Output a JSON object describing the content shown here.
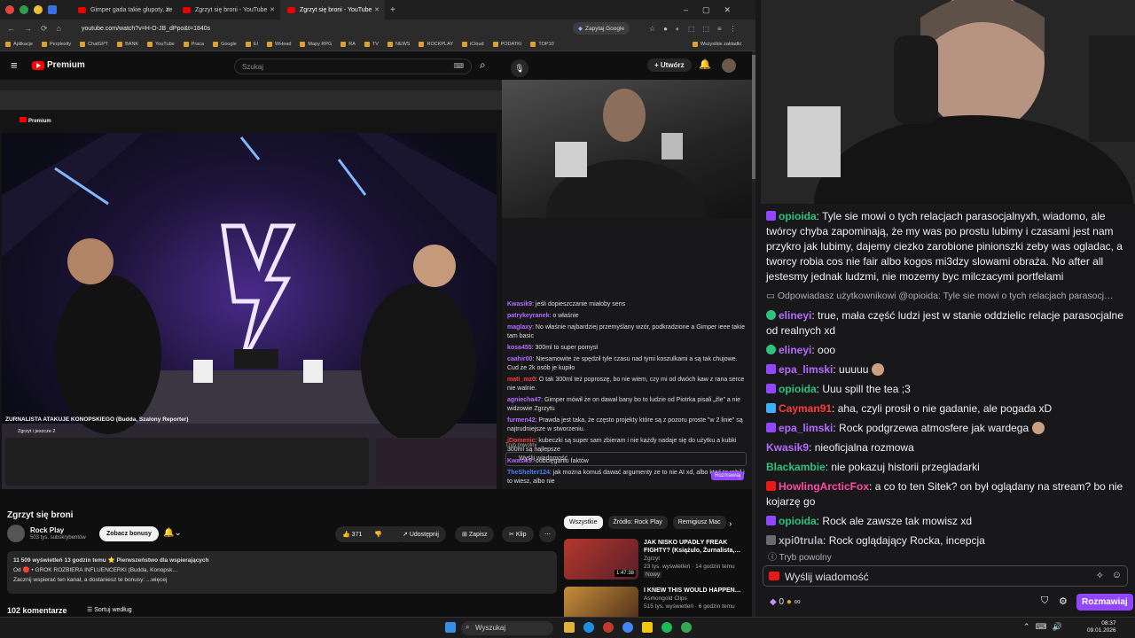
{
  "browser": {
    "tabs": [
      {
        "label": "Gimper gada takie głupoty, że"
      },
      {
        "label": "Zgrzyt się broni - YouTube"
      },
      {
        "label": "Zgrzyt się broni - YouTube"
      }
    ],
    "url": "youtube.com/watch?v=H-O-JB_dPpo&t=1840s",
    "ask_google": "Zapytaj Google",
    "bookmarks": [
      "Aplikacje",
      "Perplexity",
      "ChatGPT",
      "BANK",
      "YouTube",
      "Praca",
      "Google",
      "EI",
      "WHead",
      "Mapy RPG",
      "RA",
      "TV",
      "NEWS",
      "ROCKPLAY",
      "iCloud",
      "PODATKI",
      "TOP10"
    ],
    "all_bookmarks": "Wszystkie zakładki"
  },
  "youtube": {
    "logo": "Premium",
    "search_placeholder": "Szukaj",
    "create": "Utwórz",
    "video_title": "Zgrzyt się broni",
    "channel": "Rock Play",
    "subscribers": "503 tys. subskrybentów",
    "bonus_button": "Zobacz bonusy",
    "likes": "371",
    "share": "Udostępnij",
    "save": "Zapisz",
    "clip": "Klip",
    "desc_line1": "11 509 wyświetleń  13 godzin temu  ⭐ Pierwszeństwo dla wspierających",
    "desc_line2": "Od  🔴 • GROK ROZBIERA INFLUENCERKI (Budda, Konopsk…",
    "desc_line3": "Zacznij wspierać ten kanał, a dostaniesz te bonusy:  ...więcej",
    "comments": "102 komentarze",
    "sort": "Sortuj według",
    "chips": [
      "Wszystkie",
      "Źródło: Rock Play",
      "Remigiusz Mac"
    ],
    "recommendations": [
      {
        "title": "JAK NISKO UPADŁY FREAK FIGHTY? (Książulo, Żurnalista,…",
        "channel": "Zgrzyt",
        "meta": "23 tys. wyświetleń · 14 godzin temu",
        "badge": "Nowy",
        "duration": "1:47:38"
      },
      {
        "title": "I KNEW THIS WOULD HAPPEN…",
        "channel": "Asmongold Clips",
        "meta": "515 tys. wyświetleń · 6 godzin temu",
        "badge": "",
        "duration": ""
      }
    ]
  },
  "inner": {
    "stream_title": "ŻURNALISTA ATAKUJE KONOPSKIEGO (Budda, Szalony Reporter)",
    "channel": "Zgrzyt i jeszcze 2",
    "slow_mode": "Tryb powolny",
    "send_placeholder": "Wyślij wiadomość",
    "chat_button": "Rozmawiaj",
    "messages": [
      {
        "user": "Kwasik9",
        "color": "#b46bff",
        "text": "jeśli dopieszczanie miałoby sens"
      },
      {
        "user": "patrykeyranek",
        "color": "#b46bff",
        "text": "o właśnie"
      },
      {
        "user": "maglaxy",
        "color": "#b46bff",
        "text": "No właśnie najbardziej przemyślany wzór, podkradzione a Gimper ieee takie tam basic"
      },
      {
        "user": "kosa455",
        "color": "#b46bff",
        "text": "300ml to super pomysł"
      },
      {
        "user": "caahir00",
        "color": "#b46bff",
        "text": "Niesamowite że spędził tyle czasu nad tymi koszulkami a są tak chujowe. Cud że 2k osób je kupiło"
      },
      {
        "user": "mati_mz0",
        "color": "#ff3b3b",
        "text": "O tak 300ml też poproszę, bo nie wiem, czy mi od dwóch kaw z rana serce nie walnie."
      },
      {
        "user": "agniecha47",
        "color": "#b46bff",
        "text": "Gimper mówił że on dawał bany bo to ludzie od Piotrka pisali „źle” a nie widzowie Zgrzytu"
      },
      {
        "user": "furmen42",
        "color": "#b46bff",
        "text": "Prawda jest taka, że często projekty które są z pozoru proste \"w 2 linie\" są najtrudniejsze w stworzeniu."
      },
      {
        "user": "iDomenic",
        "color": "#ff3b3b",
        "text": "kubeczki są super sam zbieram i nie każdy nadaje się do użytku a kubki 300ml są najlepsze"
      },
      {
        "user": "Kwasik9",
        "color": "#b46bff",
        "text": "oobcięganiu faktów"
      },
      {
        "user": "TheShelter124",
        "color": "#4a7dff",
        "text": "jak można komuś dawać argumenty ze to nie AI xd, albo ktoś to robił i to wiesz, albo nie"
      }
    ]
  },
  "twitch_chat": {
    "messages": [
      {
        "user": "opioida",
        "color": "#2ec27e",
        "text": "Tyle sie mowi o tych relacjach parasocjalnyxh, wiadomo, ale twórcy chyba zapominają, że my was po prostu lubimy i czasami jest nam przykro jak lubimy, dajemy ciezko zarobione pinionszki zeby was ogladac, a tworcy robia cos nie fair albo kogos mi3dzy slowami obraża. No after all jestesmy jednak ludzmi, nie mozemy byc milczacymi portfelami"
      },
      {
        "user": "",
        "color": "#adadb8",
        "text": "Odpowiadasz użytkownikowi @opioida: Tyle sie mowi o tych relacjach parasocj…"
      },
      {
        "user": "elineyi",
        "color": "#b46bff",
        "text": "true, mała część ludzi jest w stanie oddzielic relacje parasocjalne od realnych xd"
      },
      {
        "user": "elineyi",
        "color": "#b46bff",
        "text": "ooo"
      },
      {
        "user": "epa_limski",
        "color": "#b46bff",
        "text": "uuuuu"
      },
      {
        "user": "opioida",
        "color": "#2ec27e",
        "text": "Uuu spill the tea ;3"
      },
      {
        "user": "Cayman91",
        "color": "#ff3b3b",
        "text": "aha, czyli prosił o nie gadanie, ale pogada xD"
      },
      {
        "user": "epa_limski",
        "color": "#b46bff",
        "text": "Rock podgrzewa atmosfere jak wardega"
      },
      {
        "user": "Kwasik9",
        "color": "#b46bff",
        "text": "nieoficjalna rozmowa"
      },
      {
        "user": "Blackambie",
        "color": "#2ec27e",
        "text": "nie pokazuj historii przegladarki"
      },
      {
        "user": "HowlingArcticFox",
        "color": "#ff4aa8",
        "text": "a co to ten Sitek? on był oglądany na stream? bo nie kojarzę go"
      },
      {
        "user": "opioida",
        "color": "#2ec27e",
        "text": "Rock ale zawsze tak mowisz xd"
      },
      {
        "user": "xpi0trula",
        "color": "#adadb8",
        "text": "Rock oglądający Rocka, incepcja"
      }
    ],
    "slow_mode": "Tryb powolny",
    "placeholder": "Wyślij wiadomość",
    "points": "0",
    "button": "Rozmawiaj"
  },
  "taskbar": {
    "search": "Wyszukaj",
    "time": "08:37",
    "date": "09.01.2026"
  }
}
